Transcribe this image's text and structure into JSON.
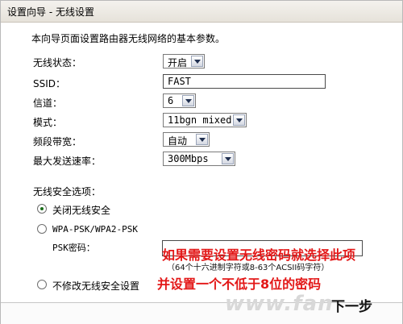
{
  "window": {
    "title": "设置向导 - 无线设置"
  },
  "intro": "本向导页面设置路由器无线网络的基本参数。",
  "fields": {
    "status": {
      "label": "无线状态：",
      "value": "开启"
    },
    "ssid": {
      "label": "SSID：",
      "value": "FAST"
    },
    "channel": {
      "label": "信道：",
      "value": "6"
    },
    "mode": {
      "label": "模式：",
      "value": "11bgn mixed"
    },
    "bandwidth": {
      "label": "频段带宽：",
      "value": "自动"
    },
    "rate": {
      "label": "最大发送速率：",
      "value": "300Mbps"
    }
  },
  "security": {
    "heading": "无线安全选项：",
    "disable": "关闭无线安全",
    "wpa": "WPA-PSK/WPA2-PSK",
    "psk_label": "PSK密码：",
    "psk_value": "",
    "nochange": "不修改无线安全设置",
    "selected": "disable"
  },
  "annotation": {
    "line1": "如果需要设置无线密码就选择此项",
    "line2": "（64个十六进制字符或8-63个ACSII码字符）",
    "line3": "并设置一个不低于8位的密码"
  },
  "footer": {
    "watermark": "www.fan",
    "next": "下一步"
  },
  "colors": {
    "annotation": "#e31818",
    "radio_selected": "#1a6d1a"
  }
}
